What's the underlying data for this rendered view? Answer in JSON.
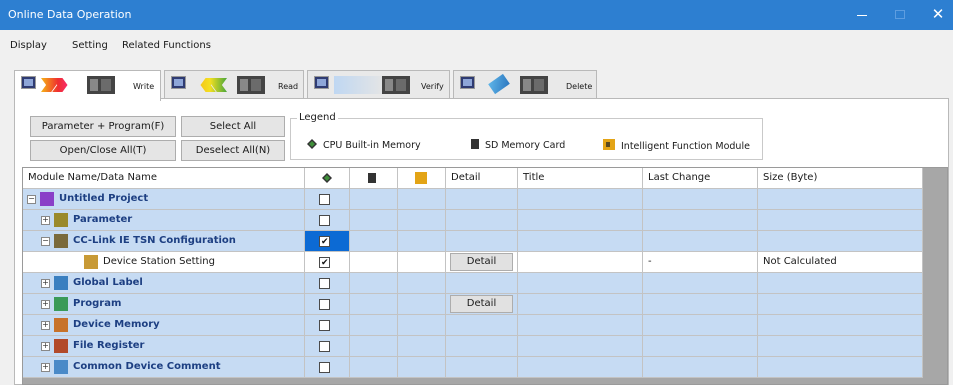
{
  "window": {
    "title": "Online Data Operation",
    "close_glyph": "✕"
  },
  "menu": [
    "Display",
    "Setting",
    "Related Functions"
  ],
  "tabs": [
    {
      "label": "Write"
    },
    {
      "label": "Read"
    },
    {
      "label": "Verify"
    },
    {
      "label": "Delete"
    }
  ],
  "buttons": {
    "param_program": "Parameter + Program(F)",
    "select_all": "Select All",
    "open_close_all": "Open/Close All(T)",
    "deselect_all": "Deselect All(N)"
  },
  "legend": {
    "title": "Legend",
    "cpu": "CPU Built-in Memory",
    "sd": "SD Memory Card",
    "ifm": "Intelligent Function Module"
  },
  "table": {
    "headers": {
      "name": "Module Name/Data Name",
      "detail": "Detail",
      "title": "Title",
      "last_change": "Last Change",
      "size": "Size (Byte)"
    },
    "rows": [
      {
        "name": "Untitled Project",
        "cpu_checked": false,
        "detail": "",
        "last_change": "",
        "size": ""
      },
      {
        "name": "Parameter",
        "cpu_checked": false,
        "detail": "",
        "last_change": "",
        "size": ""
      },
      {
        "name": "CC-Link IE TSN Configuration",
        "cpu_checked": true,
        "detail": "",
        "last_change": "",
        "size": ""
      },
      {
        "name": "Device Station Setting",
        "cpu_checked": true,
        "detail": "Detail",
        "last_change": "-",
        "size": "Not Calculated"
      },
      {
        "name": "Global Label",
        "cpu_checked": false,
        "detail": "",
        "last_change": "",
        "size": ""
      },
      {
        "name": "Program",
        "cpu_checked": false,
        "detail": "Detail",
        "last_change": "",
        "size": ""
      },
      {
        "name": "Device Memory",
        "cpu_checked": false,
        "detail": "",
        "last_change": "",
        "size": ""
      },
      {
        "name": "File Register",
        "cpu_checked": false,
        "detail": "",
        "last_change": "",
        "size": ""
      },
      {
        "name": "Common Device Comment",
        "cpu_checked": false,
        "detail": "",
        "last_change": "",
        "size": ""
      }
    ]
  },
  "colors": {
    "titlebar": "#2d7fd1",
    "row_blue": "#c6dbf3",
    "selected": "#0c6ad4",
    "node_text": "#1d3f82"
  }
}
